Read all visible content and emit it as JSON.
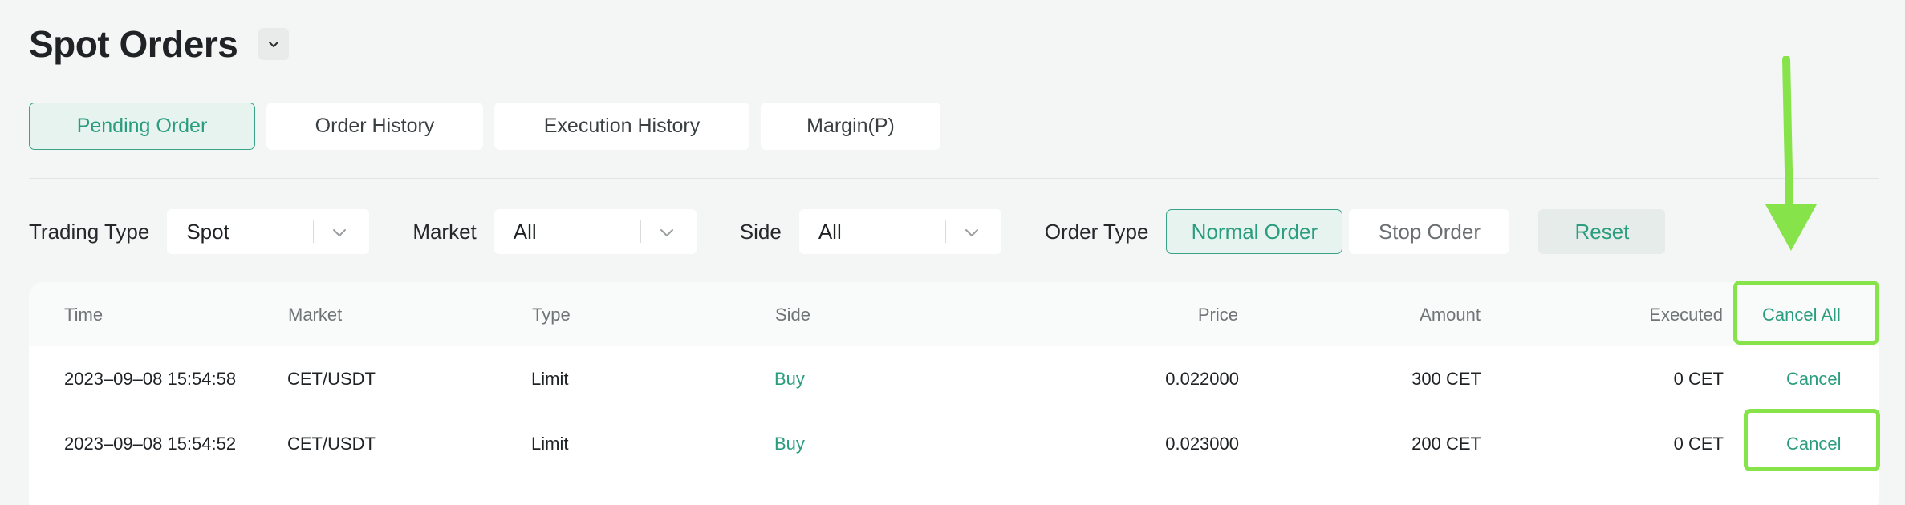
{
  "header": {
    "title": "Spot Orders"
  },
  "tabs": [
    {
      "label": "Pending Order",
      "active": true
    },
    {
      "label": "Order History",
      "active": false
    },
    {
      "label": "Execution History",
      "active": false
    },
    {
      "label": "Margin(P)",
      "active": false
    }
  ],
  "filters": {
    "trading_type": {
      "label": "Trading Type",
      "value": "Spot"
    },
    "market": {
      "label": "Market",
      "value": "All"
    },
    "side": {
      "label": "Side",
      "value": "All"
    },
    "order_type": {
      "label": "Order Type",
      "options": [
        "Normal Order",
        "Stop Order"
      ],
      "selected": "Normal Order"
    },
    "reset_label": "Reset"
  },
  "table": {
    "columns": {
      "time": "Time",
      "market": "Market",
      "type": "Type",
      "side": "Side",
      "price": "Price",
      "amount": "Amount",
      "executed": "Executed",
      "action": "Cancel All"
    },
    "rows": [
      {
        "time": "2023–09–08 15:54:58",
        "market": "CET/USDT",
        "type": "Limit",
        "side": "Buy",
        "price": "0.022000",
        "amount": "300 CET",
        "executed": "0 CET",
        "action": "Cancel"
      },
      {
        "time": "2023–09–08 15:54:52",
        "market": "CET/USDT",
        "type": "Limit",
        "side": "Buy",
        "price": "0.023000",
        "amount": "200 CET",
        "executed": "0 CET",
        "action": "Cancel"
      }
    ]
  },
  "colors": {
    "accent": "#2a9d7f",
    "accent_bg": "#e6f3ef",
    "highlight": "#86e34a",
    "background": "#f4f5f5"
  },
  "icons": {
    "title_dropdown": "chevron-down-icon",
    "select_chevron": "chevron-down-icon",
    "annotation_arrow": "arrow-down-icon"
  }
}
